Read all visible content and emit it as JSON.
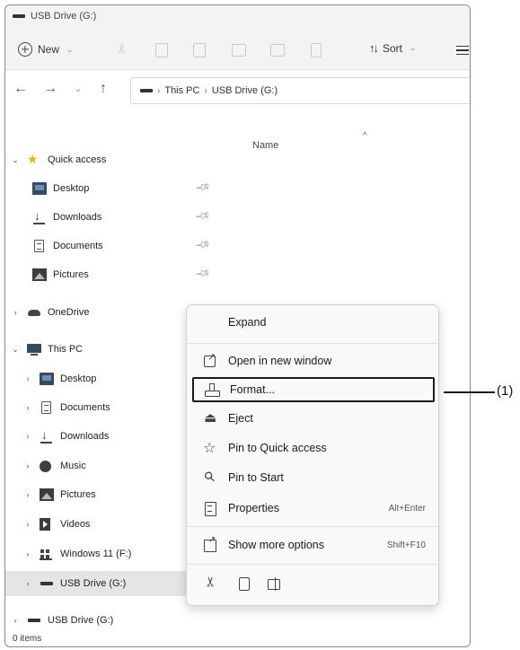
{
  "window": {
    "title": "USB Drive (G:)"
  },
  "toolbar": {
    "new_label": "New",
    "sort_label": "Sort"
  },
  "address": {
    "crumbs": [
      "This PC",
      "USB Drive (G:)"
    ]
  },
  "sidebar": {
    "quick_access": {
      "label": "Quick access",
      "items": [
        "Desktop",
        "Downloads",
        "Documents",
        "Pictures"
      ]
    },
    "onedrive": "OneDrive",
    "this_pc": {
      "label": "This PC",
      "items": [
        "Desktop",
        "Documents",
        "Downloads",
        "Music",
        "Pictures",
        "Videos",
        "Windows 11 (F:)",
        "USB Drive (G:)"
      ]
    },
    "usb_root": "USB Drive (G:)"
  },
  "content": {
    "column_name": "Name"
  },
  "status": {
    "items": "0 items"
  },
  "context_menu": {
    "items": [
      {
        "label": "Expand",
        "shortcut": "",
        "icon": "none"
      },
      {
        "label": "Open in new window",
        "shortcut": "",
        "icon": "open-new-window-icon"
      },
      {
        "label": "Format...",
        "shortcut": "",
        "icon": "format-drive-icon"
      },
      {
        "label": "Eject",
        "shortcut": "",
        "icon": "eject-icon"
      },
      {
        "label": "Pin to Quick access",
        "shortcut": "",
        "icon": "star-icon"
      },
      {
        "label": "Pin to Start",
        "shortcut": "",
        "icon": "pin-icon"
      },
      {
        "label": "Properties",
        "shortcut": "Alt+Enter",
        "icon": "properties-icon"
      },
      {
        "label": "Show more options",
        "shortcut": "Shift+F10",
        "icon": "more-options-icon"
      }
    ],
    "bottom_icons": [
      "cut-icon",
      "copy-icon",
      "rename-icon"
    ]
  },
  "annotation": {
    "label": "(1)"
  }
}
